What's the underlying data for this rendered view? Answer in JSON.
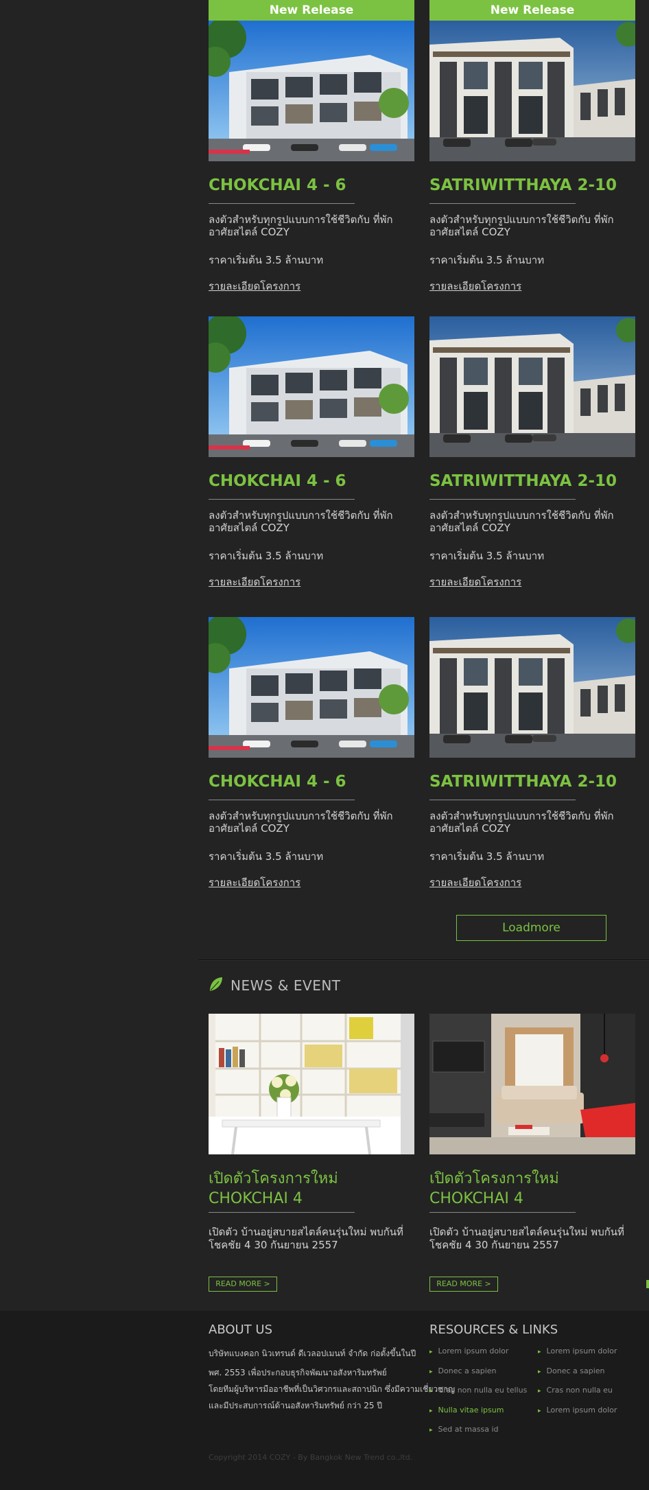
{
  "projects": [
    {
      "ribbon": "New Release",
      "title": "CHOKCHAI 4 - 6",
      "desc": "ลงตัวสำหรับทุกรูปแบบการใช้ชีวิตกับ ที่พักอาศัยสไตล์ COZY",
      "price": "ราคาเริ่มต้น 3.5 ล้านบาท",
      "link": "รายละเอียดโครงการ"
    },
    {
      "ribbon": "New Release",
      "title": "SATRIWITTHAYA 2-10",
      "desc": "ลงตัวสำหรับทุกรูปแบบการใช้ชีวิตกับ ที่พักอาศัยสไตล์ COZY",
      "price": "ราคาเริ่มต้น 3.5 ล้านบาท",
      "link": "รายละเอียดโครงการ"
    },
    {
      "title": "CHOKCHAI 4 - 6",
      "desc": "ลงตัวสำหรับทุกรูปแบบการใช้ชีวิตกับ ที่พักอาศัยสไตล์ COZY",
      "price": "ราคาเริ่มต้น 3.5 ล้านบาท",
      "link": "รายละเอียดโครงการ"
    },
    {
      "title": "SATRIWITTHAYA 2-10",
      "desc": "ลงตัวสำหรับทุกรูปแบบการใช้ชีวิตกับ ที่พักอาศัยสไตล์ COZY",
      "price": "ราคาเริ่มต้น 3.5 ล้านบาท",
      "link": "รายละเอียดโครงการ"
    },
    {
      "title": "CHOKCHAI 4 - 6",
      "desc": "ลงตัวสำหรับทุกรูปแบบการใช้ชีวิตกับ ที่พักอาศัยสไตล์ COZY",
      "price": "ราคาเริ่มต้น 3.5 ล้านบาท",
      "link": "รายละเอียดโครงการ"
    },
    {
      "title": "SATRIWITTHAYA 2-10",
      "desc": "ลงตัวสำหรับทุกรูปแบบการใช้ชีวิตกับ ที่พักอาศัยสไตล์ COZY",
      "price": "ราคาเริ่มต้น 3.5 ล้านบาท",
      "link": "รายละเอียดโครงการ"
    }
  ],
  "loadmore": "Loadmore",
  "news": {
    "heading": "NEWS & EVENT",
    "items": [
      {
        "title_line1": "เปิดตัวโครงการใหม่",
        "title_line2": "CHOKCHAI 4",
        "desc": "เปิดตัว บ้านอยู่สบายสไตล์คนรุ่นใหม่ พบกันที่ โชคชัย 4 30 กันยายน 2557",
        "readmore": "READ MORE  >"
      },
      {
        "title_line1": "เปิดตัวโครงการใหม่",
        "title_line2": "CHOKCHAI 4",
        "desc": "เปิดตัว บ้านอยู่สบายสไตล์คนรุ่นใหม่ พบกันที่ โชคชัย 4 30 กันยายน 2557",
        "readmore": "READ MORE  >"
      }
    ]
  },
  "footer": {
    "about_heading": "ABOUT US",
    "about_lines": [
      "บริษัทแบงคอก นิวเทรนด์ ดีเวลอปเมนท์ จำกัด ก่อตั้งขึ้นในปี",
      "พศ. 2553 เพื่อประกอบธุรกิจพัฒนาอสังหาริมทรัพย์",
      "โดยทีมผู้บริหารมืออาชีพที่เป็นวิศวกรและสถาปนิก ซึ่งมีความเชี่ยวชาญ",
      "และมีประสบการณ์ด้านอสังหาริมทรัพย์ กว่า 25 ปี"
    ],
    "resources_heading": "RESOURCES & LINKS",
    "resources_col1": [
      "Lorem ipsum dolor",
      "Donec a sapien",
      "Cras non nulla eu tellus",
      "Nulla vitae ipsum",
      "Sed at massa id"
    ],
    "resources_col2": [
      "Lorem ipsum dolor",
      "Donec a sapien",
      "Cras non nulla eu",
      "Lorem ipsum dolor"
    ],
    "active_link": "Nulla vitae ipsum",
    "copyright": "Copyright 2014 COZY - By Bangkok New Trend co.,ltd."
  },
  "colors": {
    "accent": "#7cc242",
    "background": "#232323",
    "footer": "#1b1b1b"
  }
}
